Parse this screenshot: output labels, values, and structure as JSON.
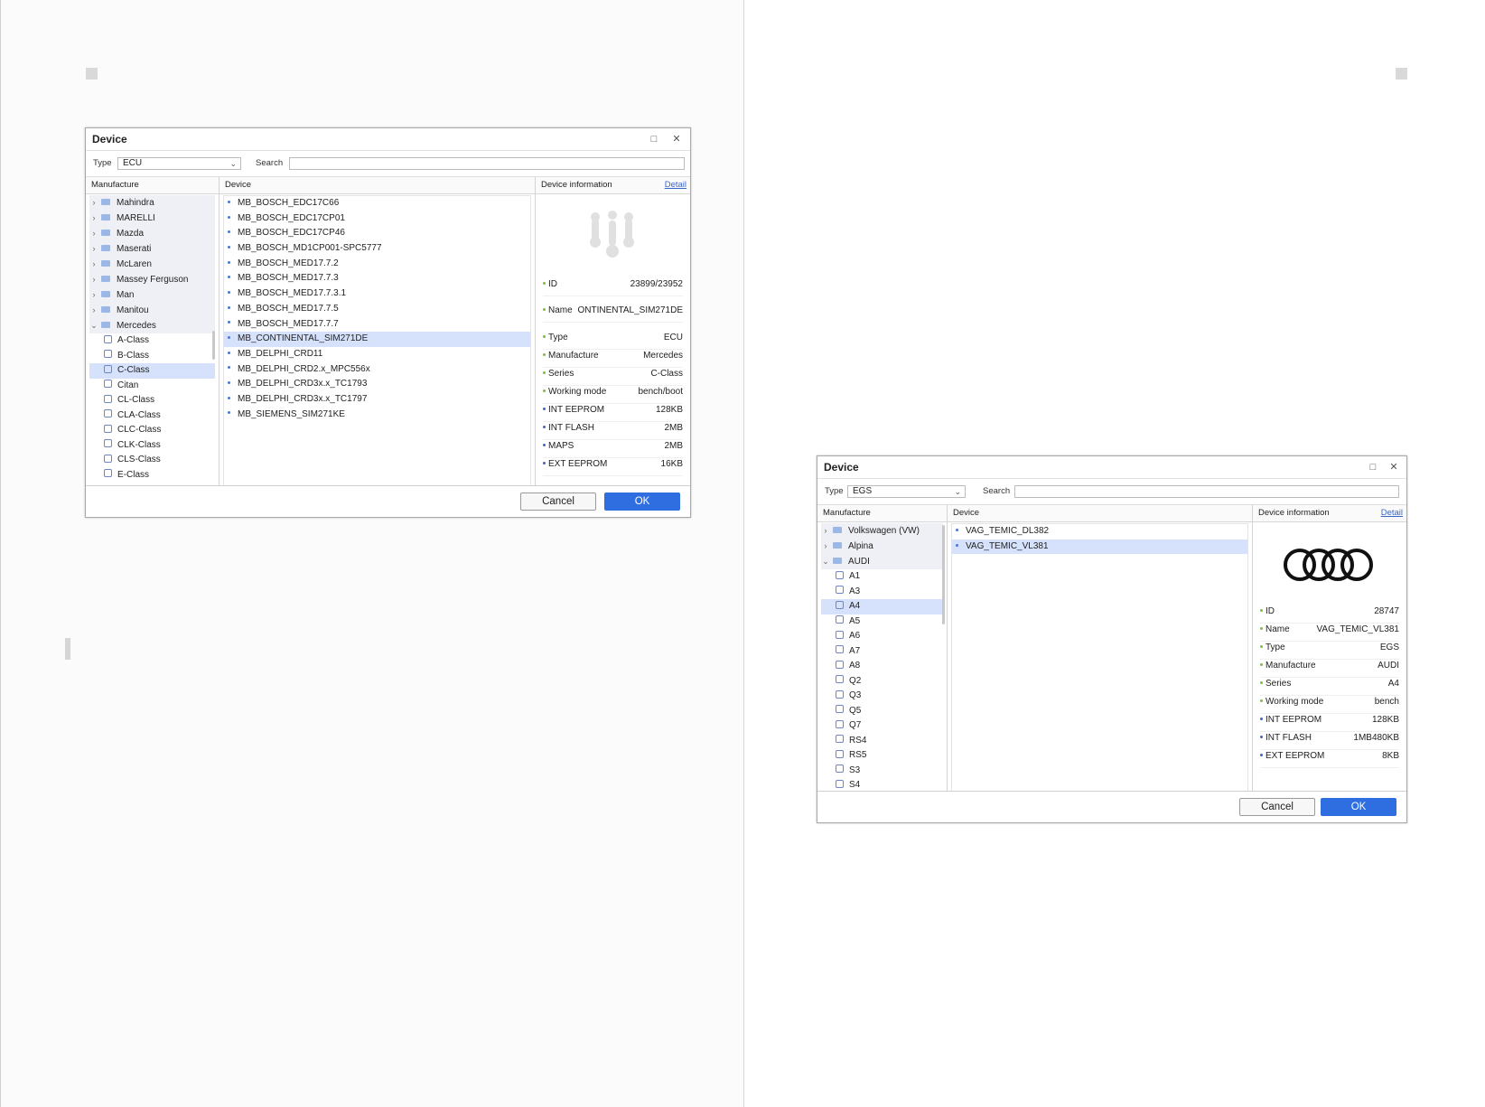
{
  "dialog1": {
    "title": "Device",
    "type_label": "Type",
    "type_value": "ECU",
    "search_label": "Search",
    "manufacture_header": "Manufacture",
    "device_header": "Device",
    "info_header": "Device information",
    "detail_link": "Detail",
    "manufacturers": [
      "Mahindra",
      "MARELLI",
      "Mazda",
      "Maserati",
      "McLaren",
      "Massey Ferguson",
      "Man",
      "Manitou",
      "Mercedes"
    ],
    "series": [
      "A-Class",
      "B-Class",
      "C-Class",
      "Citan",
      "CL-Class",
      "CLA-Class",
      "CLC-Class",
      "CLK-Class",
      "CLS-Class",
      "E-Class"
    ],
    "devices": [
      "MB_BOSCH_EDC17C66",
      "MB_BOSCH_EDC17CP01",
      "MB_BOSCH_EDC17CP46",
      "MB_BOSCH_MD1CP001-SPC5777",
      "MB_BOSCH_MED17.7.2",
      "MB_BOSCH_MED17.7.3",
      "MB_BOSCH_MED17.7.3.1",
      "MB_BOSCH_MED17.7.5",
      "MB_BOSCH_MED17.7.7",
      "MB_CONTINENTAL_SIM271DE",
      "MB_DELPHI_CRD11",
      "MB_DELPHI_CRD2.x_MPC556x",
      "MB_DELPHI_CRD3x.x_TC1793",
      "MB_DELPHI_CRD3x.x_TC1797",
      "MB_SIEMENS_SIM271KE"
    ],
    "info": {
      "id_k": "ID",
      "id_v": "23899/23952",
      "name_k": "Name",
      "name_v": "ONTINENTAL_SIM271DE",
      "type_k": "Type",
      "type_v": "ECU",
      "manu_k": "Manufacture",
      "manu_v": "Mercedes",
      "series_k": "Series",
      "series_v": "C-Class",
      "mode_k": "Working mode",
      "mode_v": "bench/boot",
      "eeprom_k": "INT EEPROM",
      "eeprom_v": "128KB",
      "flash_k": "INT FLASH",
      "flash_v": "2MB",
      "maps_k": "MAPS",
      "maps_v": "2MB",
      "ext_k": "EXT EEPROM",
      "ext_v": "16KB"
    },
    "cancel": "Cancel",
    "ok": "OK"
  },
  "dialog2": {
    "title": "Device",
    "type_label": "Type",
    "type_value": "EGS",
    "search_label": "Search",
    "manufacture_header": "Manufacture",
    "device_header": "Device",
    "info_header": "Device information",
    "detail_link": "Detail",
    "manufacturers": [
      "Volkswagen (VW)",
      "Alpina",
      "AUDI"
    ],
    "series": [
      "A1",
      "A3",
      "A4",
      "A5",
      "A6",
      "A7",
      "A8",
      "Q2",
      "Q3",
      "Q5",
      "Q7",
      "RS4",
      "RS5",
      "S3",
      "S4"
    ],
    "devices": [
      "VAG_TEMIC_DL382",
      "VAG_TEMIC_VL381"
    ],
    "info": {
      "id_k": "ID",
      "id_v": "28747",
      "name_k": "Name",
      "name_v": "VAG_TEMIC_VL381",
      "type_k": "Type",
      "type_v": "EGS",
      "manu_k": "Manufacture",
      "manu_v": "AUDI",
      "series_k": "Series",
      "series_v": "A4",
      "mode_k": "Working mode",
      "mode_v": "bench",
      "eeprom_k": "INT EEPROM",
      "eeprom_v": "128KB",
      "flash_k": "INT FLASH",
      "flash_v": "1MB480KB",
      "ext_k": "EXT EEPROM",
      "ext_v": "8KB"
    },
    "cancel": "Cancel",
    "ok": "OK"
  },
  "colors": {
    "accent": "#2f6ee0",
    "selection": "#d6e2fb",
    "link": "#3b66c8",
    "folder": "#9bb7e6"
  },
  "icons": {
    "folder": "folder-icon",
    "series": "car-icon",
    "close": "close-icon",
    "maximize": "maximize-icon",
    "dropdown": "chevron-down-icon",
    "expand": "chevron-right-icon",
    "collapse": "chevron-down-icon"
  }
}
